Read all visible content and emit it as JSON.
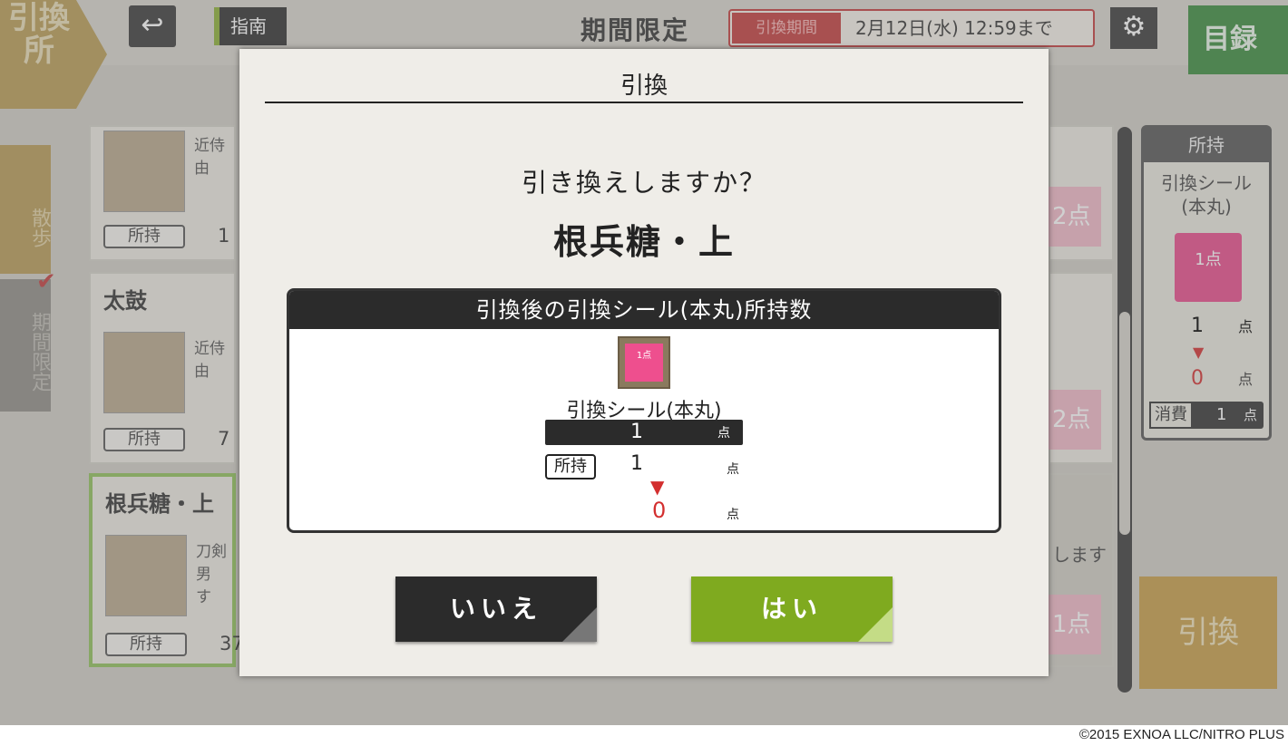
{
  "header": {
    "shop_title": "引換所",
    "back_icon": "back-arrow-icon",
    "guide_label": "指南",
    "limited_title": "期間限定",
    "period_tag": "引換期間",
    "period_end": "2月12日(水) 12:59まで",
    "settings_icon": "gear-icon",
    "catalog_label": "目録"
  },
  "side_tabs": {
    "walk": "散歩",
    "limited": "期間限定"
  },
  "item_list": [
    {
      "title": "",
      "desc": "近侍由",
      "own_label": "所持",
      "own_count": "1"
    },
    {
      "title": "太鼓",
      "desc": "近侍由",
      "own_label": "所持",
      "own_count": "7"
    },
    {
      "title": "根兵糖・上",
      "desc": "刀剣男\nす",
      "own_label": "所持",
      "own_count": "37"
    }
  ],
  "right_badges": [
    "2点",
    "2点",
    "1点"
  ],
  "behind_text": "します",
  "owned_panel": {
    "head": "所持",
    "name": "引換シール\n(本丸)",
    "icon_label": "1点",
    "before": "1",
    "after": "0",
    "unit": "点",
    "consume_label": "消費",
    "consume_value": "1",
    "consume_unit": "点"
  },
  "exchange_button": "引換",
  "modal": {
    "title": "引換",
    "question": "引き換えしますか？",
    "item_name": "根兵糖・上",
    "info_header": "引換後の引換シール(本丸)所持数",
    "seal_icon_label": "1点",
    "seal_name": "引換シール(本丸)",
    "cost_value": "1",
    "cost_unit": "点",
    "own_tag": "所持",
    "own_before": "1",
    "own_before_unit": "点",
    "own_after": "0",
    "own_after_unit": "点",
    "no_label": "いいえ",
    "yes_label": "はい"
  },
  "copyright": "©2015 EXNOA LLC/NITRO PLUS"
}
